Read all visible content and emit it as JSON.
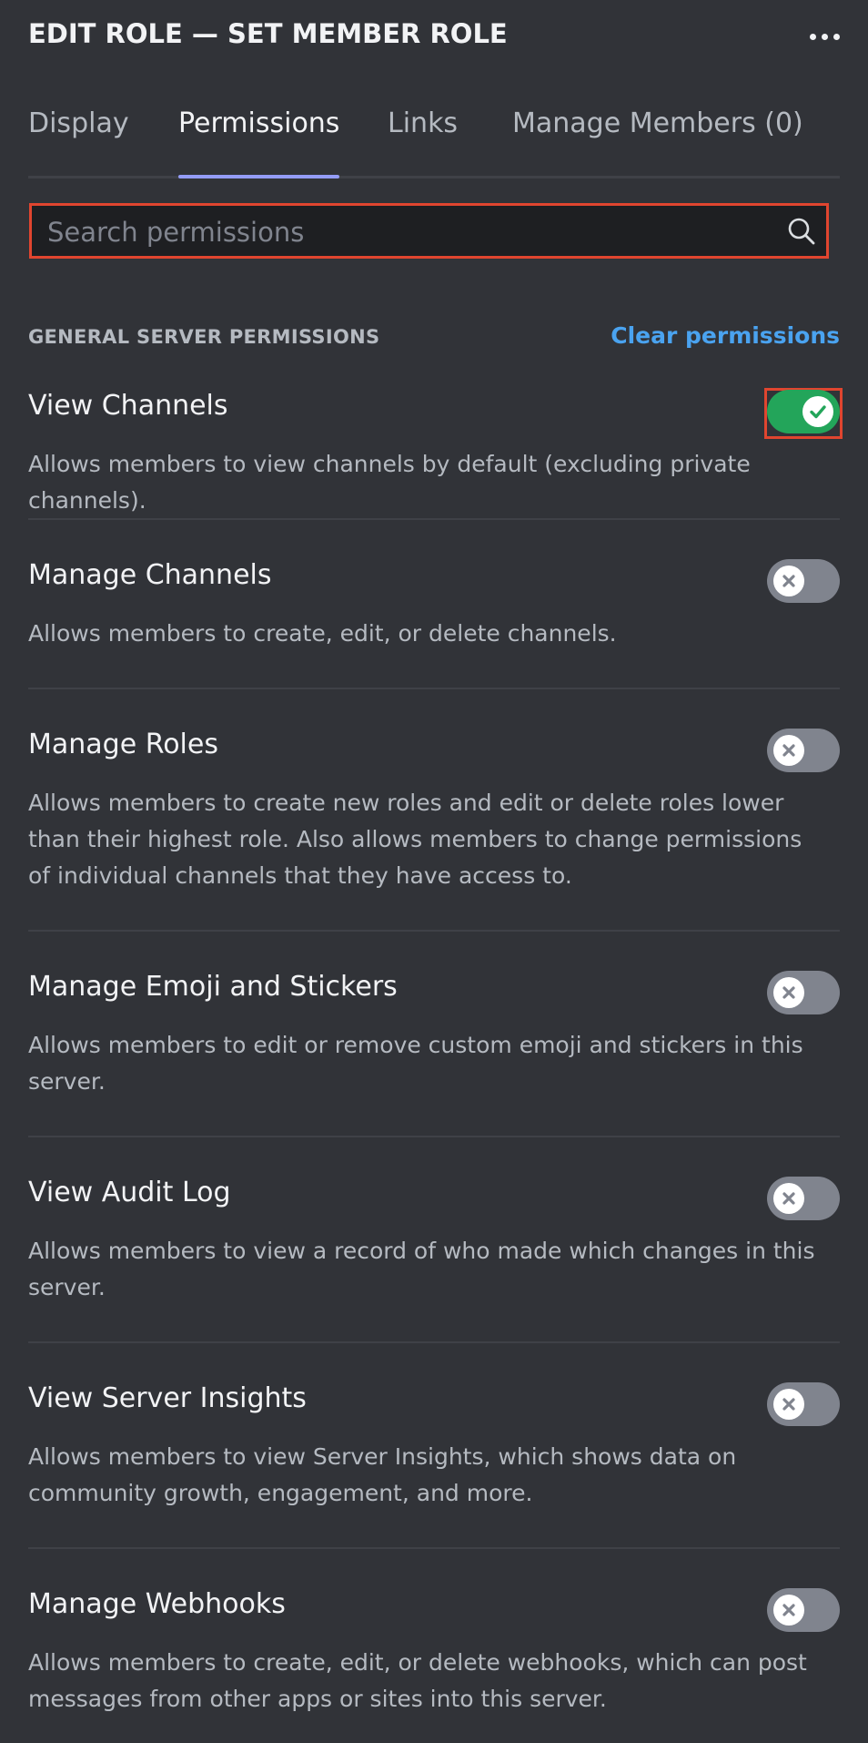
{
  "header": {
    "title": "EDIT ROLE — SET MEMBER ROLE",
    "more_icon": "more-horizontal-icon"
  },
  "tabs": [
    {
      "label": "Display",
      "active": false
    },
    {
      "label": "Permissions",
      "active": true
    },
    {
      "label": "Links",
      "active": false
    },
    {
      "label": "Manage Members (0)",
      "active": false
    }
  ],
  "search": {
    "placeholder": "Search permissions",
    "value": "",
    "icon": "search-icon"
  },
  "section": {
    "title": "GENERAL SERVER PERMISSIONS",
    "clear_label": "Clear permissions"
  },
  "permissions": [
    {
      "name": "View Channels",
      "description": "Allows members to view channels by default (excluding private channels).",
      "enabled": true
    },
    {
      "name": "Manage Channels",
      "description": "Allows members to create, edit, or delete channels.",
      "enabled": false
    },
    {
      "name": "Manage Roles",
      "description": "Allows members to create new roles and edit or delete roles lower than their highest role. Also allows members to change permissions of individual channels that they have access to.",
      "enabled": false
    },
    {
      "name": "Manage Emoji and Stickers",
      "description": "Allows members to edit or remove custom emoji and stickers in this server.",
      "enabled": false
    },
    {
      "name": "View Audit Log",
      "description": "Allows members to view a record of who made which changes in this server.",
      "enabled": false
    },
    {
      "name": "View Server Insights",
      "description": "Allows members to view Server Insights, which shows data on community growth, engagement, and more.",
      "enabled": false
    },
    {
      "name": "Manage Webhooks",
      "description": "Allows members to create, edit, or delete webhooks, which can post messages from other apps or sites into this server.",
      "enabled": false
    }
  ],
  "colors": {
    "background": "#313338",
    "toggle_on": "#23a55a",
    "toggle_off": "#80848e",
    "link": "#4aa3f0",
    "tab_indicator": "#949cf7",
    "highlight_border": "#e0452f"
  }
}
